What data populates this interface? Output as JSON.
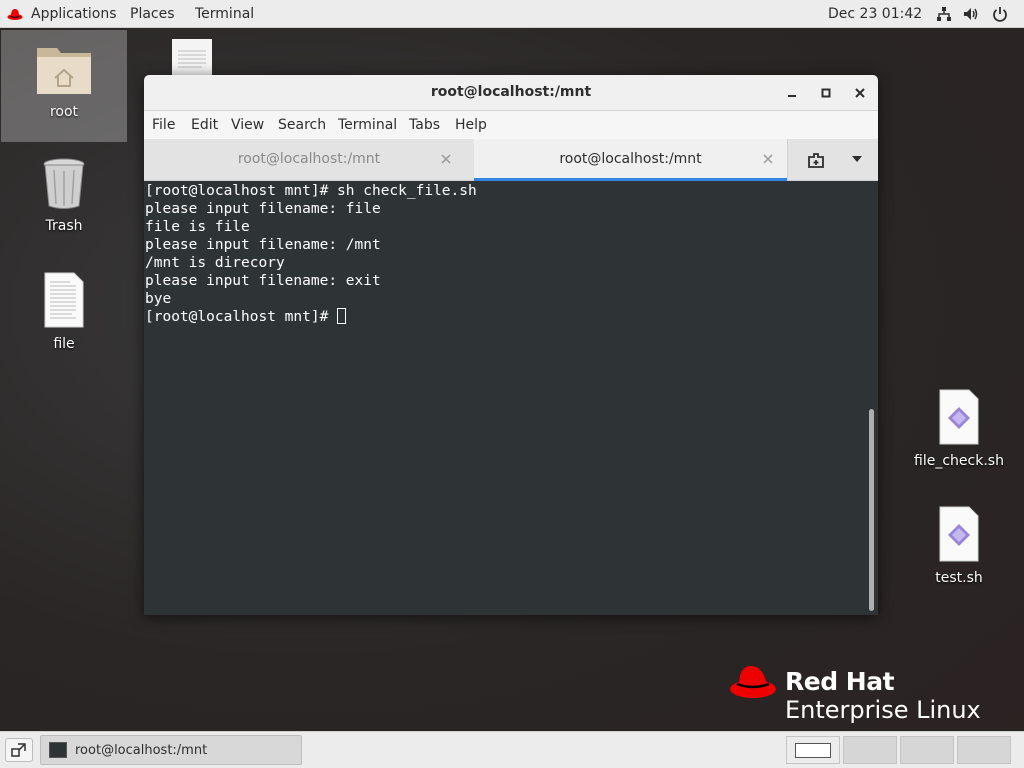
{
  "topbar": {
    "applications": "Applications",
    "places": "Places",
    "terminal": "Terminal",
    "clock": "Dec 23  01:42"
  },
  "desktop": {
    "icons": [
      {
        "label": "root",
        "icon": "home-folder-icon"
      },
      {
        "label": "Trash",
        "icon": "trash-icon"
      },
      {
        "label": "file",
        "icon": "text-file-icon"
      },
      {
        "label": "file_check.sh",
        "icon": "shell-script-icon"
      },
      {
        "label": "test.sh",
        "icon": "shell-script-icon"
      }
    ]
  },
  "window": {
    "title": "root@localhost:/mnt",
    "menu": [
      "File",
      "Edit",
      "View",
      "Search",
      "Terminal",
      "Tabs",
      "Help"
    ],
    "tabs": [
      {
        "label": "root@localhost:/mnt",
        "active": false
      },
      {
        "label": "root@localhost:/mnt",
        "active": true
      }
    ],
    "terminal_lines": [
      "[root@localhost mnt]# sh check_file.sh",
      "please input filename: file",
      "file is file",
      "please input filename: /mnt",
      "/mnt is direcory",
      "please input filename: exit",
      "bye",
      "[root@localhost mnt]# "
    ]
  },
  "branding": {
    "line1": "Red Hat",
    "line2": "Enterprise Linux"
  },
  "taskbar": {
    "window_button": "root@localhost:/mnt"
  },
  "colors": {
    "terminal_bg": "#2e3436",
    "tab_accent": "#3584e4",
    "redhat_red": "#ee0000"
  }
}
